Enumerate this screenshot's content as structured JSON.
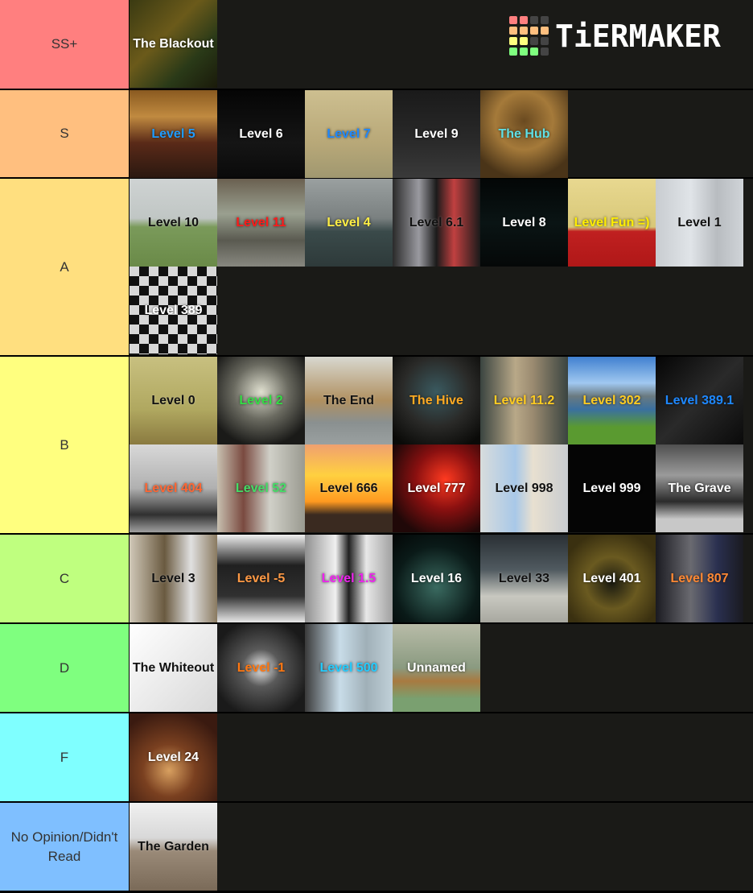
{
  "logo": {
    "text": "TiERMAKER",
    "grid_colors": [
      "#ff7f7f",
      "#ff7f7f",
      "#444444",
      "#444444",
      "#ffbf7f",
      "#ffbf7f",
      "#ffbf7f",
      "#ffbf7f",
      "#ffff7f",
      "#ffff7f",
      "#444444",
      "#444444",
      "#7fff7f",
      "#7fff7f",
      "#7fff7f",
      "#444444"
    ]
  },
  "tiers": [
    {
      "label": "SS+",
      "color": "#ff7f7f",
      "items": [
        {
          "label": "The Blackout",
          "text_color": "#ffffff",
          "bg": "linear-gradient(135deg,#3a3a12,#6b5a1a 40%,#2a3a18 70%,#1a1a0a)"
        }
      ]
    },
    {
      "label": "S",
      "color": "#ffbf7f",
      "items": [
        {
          "label": "Level 5",
          "text_color": "#1e9bff",
          "bg": "linear-gradient(180deg,#8a5a20,#c08a40 30%,#5a2a18 60%,#2a1810)"
        },
        {
          "label": "Level 6",
          "text_color": "#ffffff",
          "bg": "linear-gradient(180deg,#050505,#151515 60%,#0a0a0a)"
        },
        {
          "label": "Level 7",
          "text_color": "#1e88ff",
          "bg": "linear-gradient(180deg,#cdbf90,#b8a878 60%,#a09870)"
        },
        {
          "label": "Level 9",
          "text_color": "#ffffff",
          "bg": "linear-gradient(180deg,#1a1a1a,#2a2a2a 60%,#3a3a3a)"
        },
        {
          "label": "The Hub",
          "text_color": "#5fe0e6",
          "bg": "radial-gradient(circle at 50% 35%,#6a4a20,#a57a3a 40%,#4a3418 80%)"
        }
      ]
    },
    {
      "label": "A",
      "color": "#ffdf7f",
      "items": [
        {
          "label": "Level 10",
          "text_color": "#111111",
          "bg": "linear-gradient(180deg,#cfd3d3,#c0c6c4 45%,#7a9a5a 55%,#6a8a48)"
        },
        {
          "label": "Level 11",
          "text_color": "#ff1a1a",
          "bg": "linear-gradient(180deg,#6a6050,#9aa090 40%,#5a5a50 70%,#888880)"
        },
        {
          "label": "Level 4",
          "text_color": "#ffee44",
          "bg": "linear-gradient(180deg,#9aa0a0,#7a8080 45%,#3a4a4a 60%,#2e3a3a)"
        },
        {
          "label": "Level 6.1",
          "text_color": "#111111",
          "bg": "linear-gradient(90deg,#2a2a2a,#9a9aa0 30%,#1a1a1a 50%,#c04040 70%,#1a1a1a)"
        },
        {
          "label": "Level 8",
          "text_color": "#ffffff",
          "bg": "linear-gradient(180deg,#030606,#0a1414 50%,#050808)"
        },
        {
          "label": "Level Fun =)",
          "text_color": "#ffee00",
          "bg": "linear-gradient(180deg,#e8d890,#d8c878 55%,#c02020 60%,#b01818)"
        },
        {
          "label": "Level 1",
          "text_color": "#111111",
          "bg": "linear-gradient(90deg,#c8ccd0,#e0e4e8 40%,#b8bcc0 70%,#d0d4d8)"
        },
        {
          "label": "Level 389",
          "text_color": "#ffffff",
          "bg": "repeating-conic-gradient(#111 0% 25%,#d8d8d8 0% 50%) 0 0/24px 24px"
        }
      ]
    },
    {
      "label": "B",
      "color": "#ffff7f",
      "items": [
        {
          "label": "Level 0",
          "text_color": "#111111",
          "bg": "linear-gradient(180deg,#c8c080,#b0a860 60%,#8a7a40)"
        },
        {
          "label": "Level 2",
          "text_color": "#33dd44",
          "bg": "radial-gradient(circle at 50% 40%,#e0e0d0,#6a6a60 40%,#1a1a18 80%)"
        },
        {
          "label": "The End",
          "text_color": "#111111",
          "bg": "linear-gradient(180deg,#d8d8d0,#b09060 50%,#8a9090 75%,#9aa0a0)"
        },
        {
          "label": "The Hive",
          "text_color": "#ffaa22",
          "bg": "radial-gradient(circle at 50% 40%,#3a5a60,#2a2a28 50%,#0a0a08 90%)"
        },
        {
          "label": "Level 11.2",
          "text_color": "#ffcc22",
          "bg": "linear-gradient(90deg,#3a4440,#b8a888 40%,#9a8a70 60%,#3a4440)"
        },
        {
          "label": "Level 302",
          "text_color": "#ffcc22",
          "bg": "linear-gradient(180deg,#4080d0,#a0c8f0 30%,#6a7a80 45%,#3a70a0 60%,#5a9a30 80%)"
        },
        {
          "label": "Level 389.1",
          "text_color": "#1e88ff",
          "bg": "linear-gradient(135deg,#050505,#2a2a2a 50%,#0a0a0a)"
        },
        {
          "label": "Level 404",
          "text_color": "#ff6633",
          "bg": "linear-gradient(180deg,#d8d8d8,#b0b0b0 50%,#303030 80%,#a0a0a0)"
        },
        {
          "label": "Level 52",
          "text_color": "#44dd66",
          "bg": "linear-gradient(90deg,#c8c0b0,#7a4a40 30%,#d0d0c8 60%,#9a9a90)"
        },
        {
          "label": "Level 666",
          "text_color": "#111111",
          "bg": "linear-gradient(180deg,#f0a070,#ffd040 35%,#ff9a20 65%,#3a2a20 80%)"
        },
        {
          "label": "Level 777",
          "text_color": "#ffffff",
          "bg": "radial-gradient(circle at 60% 40%,#ff3a20,#8a1010 40%,#200808 80%)"
        },
        {
          "label": "Level 998",
          "text_color": "#111111",
          "bg": "linear-gradient(90deg,#d8dcdc,#a8c8e8 40%,#e8e0d0 60%,#c8ccd0)"
        },
        {
          "label": "Level 999",
          "text_color": "#ffffff",
          "bg": "#050505"
        },
        {
          "label": "The Grave",
          "text_color": "#ffffff",
          "bg": "linear-gradient(180deg,#505050,#9a9a9a 35%,#2a2a2a 65%,#c8c8c8 85%)"
        }
      ]
    },
    {
      "label": "C",
      "color": "#bfff7f",
      "items": [
        {
          "label": "Level 3",
          "text_color": "#111111",
          "bg": "linear-gradient(90deg,#d0c8b8,#6a5a40 40%,#e0e0e0 70%,#8a7a60)"
        },
        {
          "label": "Level -5",
          "text_color": "#ff9944",
          "bg": "linear-gradient(180deg,#f0f0f0,#202020 35%,#303030 70%,#e8e8e8)"
        },
        {
          "label": "Level 1.5",
          "text_color": "#ee22ee",
          "bg": "linear-gradient(90deg,#909090,#f0f0f0 35%,#202020 50%,#e8e8e8 70%,#a0a0a0)"
        },
        {
          "label": "Level 16",
          "text_color": "#ffffff",
          "bg": "radial-gradient(circle at 50% 60%,#3a6a60,#0a1a18 60%,#030606)"
        },
        {
          "label": "Level 33",
          "text_color": "#111111",
          "bg": "linear-gradient(180deg,#2a3034,#505a60 40%,#c8c8c0 70%,#a8a8a0)"
        },
        {
          "label": "Level 401",
          "text_color": "#ffffff",
          "bg": "radial-gradient(circle at 50% 55%,#1a1a10,#6a5a20 40%,#3a3010 80%)"
        },
        {
          "label": "Level 807",
          "text_color": "#ff8833",
          "bg": "linear-gradient(90deg,#1a1a20,#6a6a70 40%,#2a3050 70%,#1a1a20)"
        }
      ]
    },
    {
      "label": "D",
      "color": "#7fff7f",
      "items": [
        {
          "label": "The Whiteout",
          "text_color": "#111111",
          "bg": "linear-gradient(135deg,#ffffff,#e8e8e8 60%,#d8d8d8)"
        },
        {
          "label": "Level -1",
          "text_color": "#ff7711",
          "bg": "radial-gradient(circle at 50% 50%,#f0f0f0,#5a5a5a 30%,#1a1a1a 80%)"
        },
        {
          "label": "Level 500",
          "text_color": "#22ccff",
          "bg": "linear-gradient(90deg,#3a3a3a,#c8dce8 40%,#a0b0b8 70%,#c0d0d8)"
        },
        {
          "label": "Unnamed",
          "text_color": "#ffffff",
          "bg": "linear-gradient(180deg,#b8bca8,#8a9a80 50%,#a87a40 65%,#7aa070 85%)"
        }
      ]
    },
    {
      "label": "F",
      "color": "#7fffff",
      "items": [
        {
          "label": "Level 24",
          "text_color": "#ffffff",
          "bg": "radial-gradient(circle at 45% 65%,#d8a060,#7a4020 35%,#3a1a10 80%)"
        }
      ]
    },
    {
      "label": "No Opinion/Didn't Read",
      "color": "#7fbfff",
      "items": [
        {
          "label": "The Garden",
          "text_color": "#111111",
          "bg": "linear-gradient(180deg,#f0f0f0,#d8d8d8 40%,#9a8a78 55%,#7a6a58)"
        }
      ]
    }
  ]
}
